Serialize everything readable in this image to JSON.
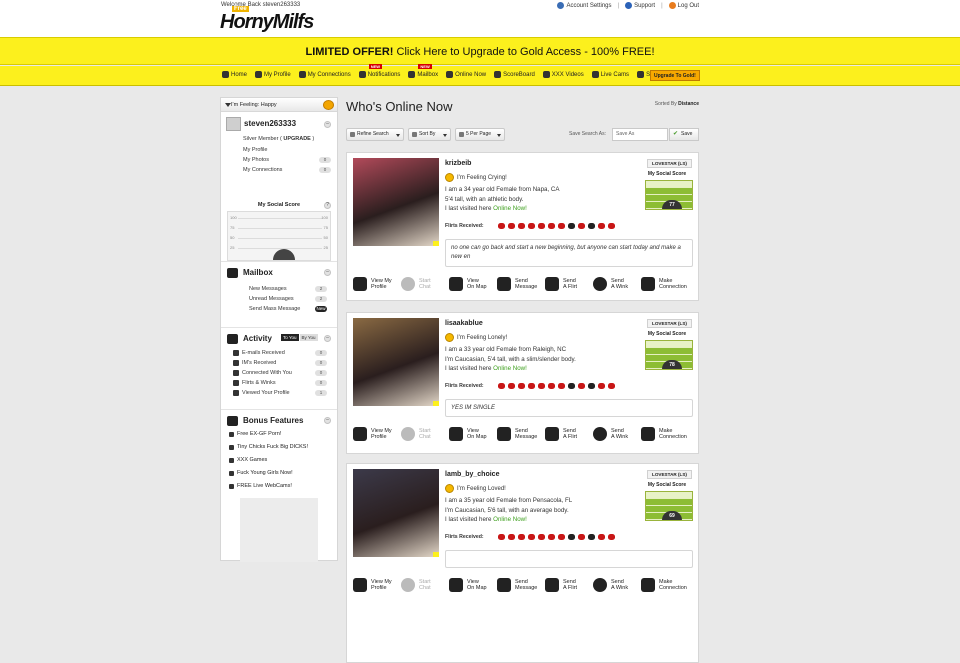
{
  "header": {
    "welcome": "Welcome Back steven263333",
    "logo_text": "HornyMilfs",
    "logo_tag": "Free",
    "links": [
      {
        "label": "Account Settings",
        "icon": "wrench-icon"
      },
      {
        "label": "Support",
        "icon": "info-icon"
      },
      {
        "label": "Log Out",
        "icon": "power-icon"
      }
    ]
  },
  "promo": {
    "strong": "LIMITED OFFER!",
    "rest": " Click Here to Upgrade to Gold Access - 100% FREE!"
  },
  "nav": {
    "items": [
      {
        "label": "Home",
        "icon": "home-icon",
        "badge": ""
      },
      {
        "label": "My Profile",
        "icon": "profile-icon",
        "badge": ""
      },
      {
        "label": "My Connections",
        "icon": "connections-icon",
        "badge": ""
      },
      {
        "label": "Notifications",
        "icon": "notifications-icon",
        "badge": "NEW"
      },
      {
        "label": "Mailbox",
        "icon": "mailbox-icon",
        "badge": "NEW"
      },
      {
        "label": "Online Now",
        "icon": "online-icon",
        "badge": ""
      },
      {
        "label": "ScoreBoard",
        "icon": "scoreboard-icon",
        "badge": ""
      },
      {
        "label": "XXX Videos",
        "icon": "video-icon",
        "badge": ""
      },
      {
        "label": "Live Cams",
        "icon": "cam-icon",
        "badge": ""
      },
      {
        "label": "Search",
        "icon": "search-icon",
        "badge": ""
      }
    ],
    "upgrade": "Upgrade To Gold!"
  },
  "sidebar": {
    "feeling": "I'm Feeling: Happy",
    "username": "steven263333",
    "member_label": "Silver Member (",
    "member_upgrade": "UPGRADE",
    "member_close": ")",
    "profile_links": [
      {
        "label": "My Profile",
        "count": ""
      },
      {
        "label": "My Photos",
        "count": "0"
      },
      {
        "label": "My Connections",
        "count": "0"
      }
    ],
    "social_score_title": "My Social Score",
    "score_ticks": [
      "100",
      "75",
      "50",
      "25"
    ],
    "mailbox_title": "Mailbox",
    "mailbox_rows": [
      {
        "label": "New Messages",
        "count": "2"
      },
      {
        "label": "Unread Messages",
        "count": "2"
      },
      {
        "label": "Send Mass Message",
        "count": "New"
      }
    ],
    "activity_title": "Activity",
    "activity_tabs": [
      "To You",
      "By You"
    ],
    "activity_rows": [
      {
        "label": "E-mails Received",
        "count": "0"
      },
      {
        "label": "IM's Received",
        "count": "0"
      },
      {
        "label": "Connected With You",
        "count": "0"
      },
      {
        "label": "Flirts & Winks",
        "count": "0"
      },
      {
        "label": "Viewed Your Profile",
        "count": "1"
      }
    ],
    "bonus_title": "Bonus Features",
    "bonus_rows": [
      "Free EX-GF Porn!",
      "Tiny Chicks Fuck Big DICKS!",
      "XXX Games",
      "Fuck Young Girls Now!",
      "FREE Live WebCams!"
    ]
  },
  "main": {
    "title": "Who's Online Now",
    "sorted_prefix": "Sorted By ",
    "sorted_value": "Distance",
    "toolbar": {
      "refine": "Refine Search",
      "sort": "Sort By",
      "perpage": "5 Per Page",
      "save_label": "Save Search As:",
      "save_placeholder": "Save As",
      "save_btn": "Save"
    },
    "flirts_label": "Flirts Received:",
    "lovestar": "LOVESTAR (LS)",
    "social_score": "My Social Score",
    "actions": [
      "View My\nProfile",
      "Start\nChat",
      "View\nOn Map",
      "Send\nMessage",
      "Send\nA Flirt",
      "Send\nA Wink",
      "Make\nConnection"
    ],
    "profiles": [
      {
        "username": "krizbeib",
        "mood": "I'm Feeling Crying!",
        "bio1": "I am a 34 year old Female from Napa, CA",
        "bio2": "5'4 tall, with an athletic body.",
        "visited": "I last visited here ",
        "online": "Online Now!",
        "quote": "no one can go back and start a new beginning, but anyone can start today and make a new en",
        "score": "77",
        "photo_color": "#b24a5a"
      },
      {
        "username": "lisaakablue",
        "mood": "I'm Feeling Lonely!",
        "bio1": "I am a 33 year old Female from Raleigh, NC",
        "bio2": "I'm Caucasian, 5'4 tall, with a slim/slender body.",
        "visited": "I last visited here ",
        "online": "Online Now!",
        "quote": "YES IM SINGLE",
        "score": "78",
        "photo_color": "#8a6a43"
      },
      {
        "username": "lamb_by_choice",
        "mood": "I'm Feeling Loved!",
        "bio1": "I am a 35 year old Female from Pensacola, FL",
        "bio2": "I'm Caucasian, 5'6 tall, with an average body.",
        "visited": "I last visited here ",
        "online": "Online Now!",
        "quote": "",
        "score": "69",
        "photo_color": "#3c3a4a"
      }
    ]
  }
}
